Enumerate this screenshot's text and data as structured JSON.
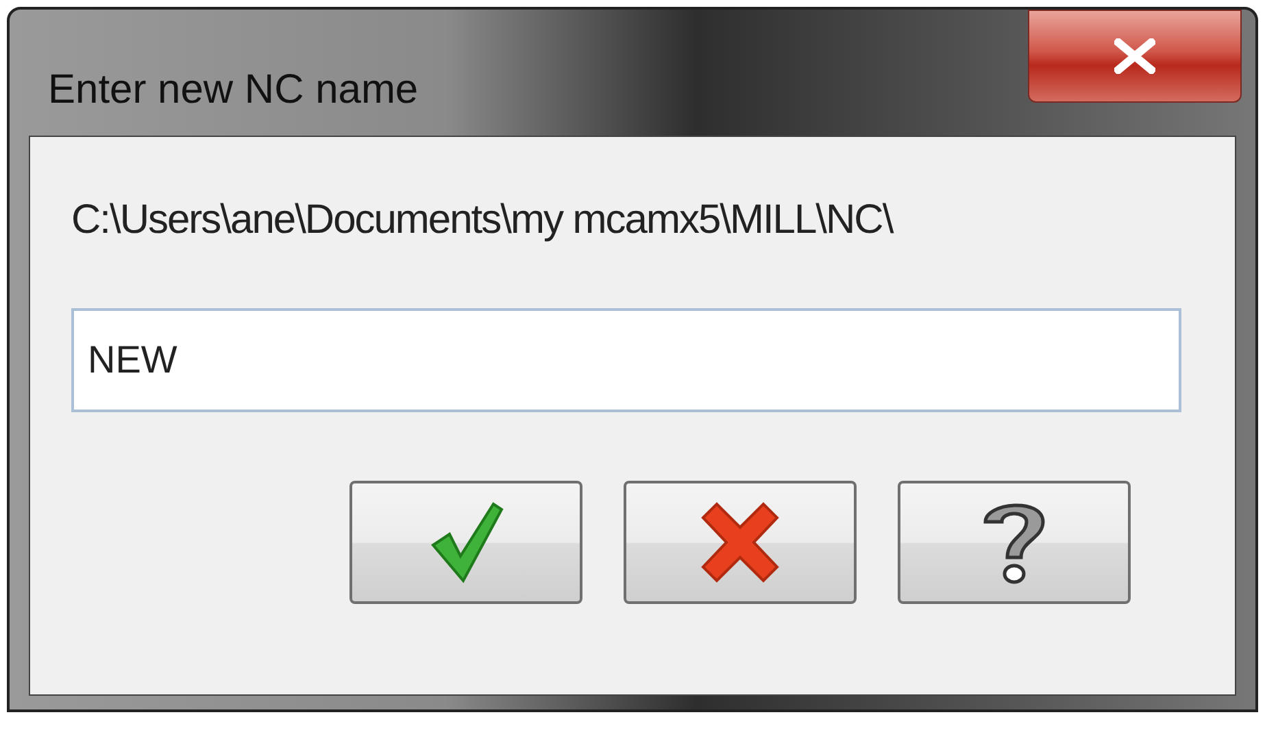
{
  "window": {
    "title": "Enter new NC name"
  },
  "path_label": "C:\\Users\\ane\\Documents\\my mcamx5\\MILL\\NC\\",
  "name_field": {
    "value": "NEW"
  },
  "buttons": [
    {
      "kind": "ok"
    },
    {
      "kind": "cancel"
    },
    {
      "kind": "help"
    }
  ]
}
